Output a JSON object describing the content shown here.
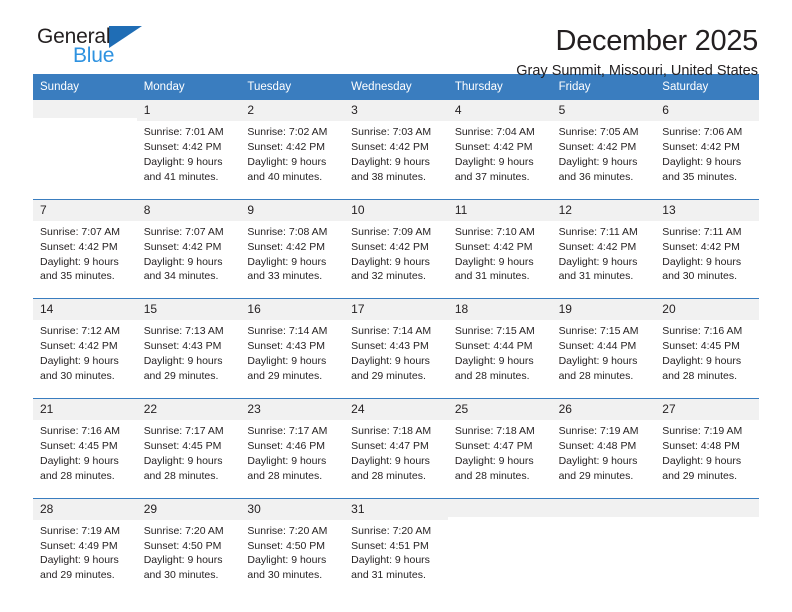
{
  "logo": {
    "line1": "General",
    "line2": "Blue",
    "triangle_color": "#1f6db5",
    "line2_color": "#2e92e0"
  },
  "header": {
    "title": "December 2025",
    "subtitle": "Gray Summit, Missouri, United States"
  },
  "calendar": {
    "header_bg": "#3a7dbf",
    "day_strip_bg": "#f1f1f1",
    "weekdays": [
      "Sunday",
      "Monday",
      "Tuesday",
      "Wednesday",
      "Thursday",
      "Friday",
      "Saturday"
    ],
    "weeks": [
      [
        {
          "day": "",
          "lines": []
        },
        {
          "day": "1",
          "lines": [
            "Sunrise: 7:01 AM",
            "Sunset: 4:42 PM",
            "Daylight: 9 hours",
            "and 41 minutes."
          ]
        },
        {
          "day": "2",
          "lines": [
            "Sunrise: 7:02 AM",
            "Sunset: 4:42 PM",
            "Daylight: 9 hours",
            "and 40 minutes."
          ]
        },
        {
          "day": "3",
          "lines": [
            "Sunrise: 7:03 AM",
            "Sunset: 4:42 PM",
            "Daylight: 9 hours",
            "and 38 minutes."
          ]
        },
        {
          "day": "4",
          "lines": [
            "Sunrise: 7:04 AM",
            "Sunset: 4:42 PM",
            "Daylight: 9 hours",
            "and 37 minutes."
          ]
        },
        {
          "day": "5",
          "lines": [
            "Sunrise: 7:05 AM",
            "Sunset: 4:42 PM",
            "Daylight: 9 hours",
            "and 36 minutes."
          ]
        },
        {
          "day": "6",
          "lines": [
            "Sunrise: 7:06 AM",
            "Sunset: 4:42 PM",
            "Daylight: 9 hours",
            "and 35 minutes."
          ]
        }
      ],
      [
        {
          "day": "7",
          "lines": [
            "Sunrise: 7:07 AM",
            "Sunset: 4:42 PM",
            "Daylight: 9 hours",
            "and 35 minutes."
          ]
        },
        {
          "day": "8",
          "lines": [
            "Sunrise: 7:07 AM",
            "Sunset: 4:42 PM",
            "Daylight: 9 hours",
            "and 34 minutes."
          ]
        },
        {
          "day": "9",
          "lines": [
            "Sunrise: 7:08 AM",
            "Sunset: 4:42 PM",
            "Daylight: 9 hours",
            "and 33 minutes."
          ]
        },
        {
          "day": "10",
          "lines": [
            "Sunrise: 7:09 AM",
            "Sunset: 4:42 PM",
            "Daylight: 9 hours",
            "and 32 minutes."
          ]
        },
        {
          "day": "11",
          "lines": [
            "Sunrise: 7:10 AM",
            "Sunset: 4:42 PM",
            "Daylight: 9 hours",
            "and 31 minutes."
          ]
        },
        {
          "day": "12",
          "lines": [
            "Sunrise: 7:11 AM",
            "Sunset: 4:42 PM",
            "Daylight: 9 hours",
            "and 31 minutes."
          ]
        },
        {
          "day": "13",
          "lines": [
            "Sunrise: 7:11 AM",
            "Sunset: 4:42 PM",
            "Daylight: 9 hours",
            "and 30 minutes."
          ]
        }
      ],
      [
        {
          "day": "14",
          "lines": [
            "Sunrise: 7:12 AM",
            "Sunset: 4:42 PM",
            "Daylight: 9 hours",
            "and 30 minutes."
          ]
        },
        {
          "day": "15",
          "lines": [
            "Sunrise: 7:13 AM",
            "Sunset: 4:43 PM",
            "Daylight: 9 hours",
            "and 29 minutes."
          ]
        },
        {
          "day": "16",
          "lines": [
            "Sunrise: 7:14 AM",
            "Sunset: 4:43 PM",
            "Daylight: 9 hours",
            "and 29 minutes."
          ]
        },
        {
          "day": "17",
          "lines": [
            "Sunrise: 7:14 AM",
            "Sunset: 4:43 PM",
            "Daylight: 9 hours",
            "and 29 minutes."
          ]
        },
        {
          "day": "18",
          "lines": [
            "Sunrise: 7:15 AM",
            "Sunset: 4:44 PM",
            "Daylight: 9 hours",
            "and 28 minutes."
          ]
        },
        {
          "day": "19",
          "lines": [
            "Sunrise: 7:15 AM",
            "Sunset: 4:44 PM",
            "Daylight: 9 hours",
            "and 28 minutes."
          ]
        },
        {
          "day": "20",
          "lines": [
            "Sunrise: 7:16 AM",
            "Sunset: 4:45 PM",
            "Daylight: 9 hours",
            "and 28 minutes."
          ]
        }
      ],
      [
        {
          "day": "21",
          "lines": [
            "Sunrise: 7:16 AM",
            "Sunset: 4:45 PM",
            "Daylight: 9 hours",
            "and 28 minutes."
          ]
        },
        {
          "day": "22",
          "lines": [
            "Sunrise: 7:17 AM",
            "Sunset: 4:45 PM",
            "Daylight: 9 hours",
            "and 28 minutes."
          ]
        },
        {
          "day": "23",
          "lines": [
            "Sunrise: 7:17 AM",
            "Sunset: 4:46 PM",
            "Daylight: 9 hours",
            "and 28 minutes."
          ]
        },
        {
          "day": "24",
          "lines": [
            "Sunrise: 7:18 AM",
            "Sunset: 4:47 PM",
            "Daylight: 9 hours",
            "and 28 minutes."
          ]
        },
        {
          "day": "25",
          "lines": [
            "Sunrise: 7:18 AM",
            "Sunset: 4:47 PM",
            "Daylight: 9 hours",
            "and 28 minutes."
          ]
        },
        {
          "day": "26",
          "lines": [
            "Sunrise: 7:19 AM",
            "Sunset: 4:48 PM",
            "Daylight: 9 hours",
            "and 29 minutes."
          ]
        },
        {
          "day": "27",
          "lines": [
            "Sunrise: 7:19 AM",
            "Sunset: 4:48 PM",
            "Daylight: 9 hours",
            "and 29 minutes."
          ]
        }
      ],
      [
        {
          "day": "28",
          "lines": [
            "Sunrise: 7:19 AM",
            "Sunset: 4:49 PM",
            "Daylight: 9 hours",
            "and 29 minutes."
          ]
        },
        {
          "day": "29",
          "lines": [
            "Sunrise: 7:20 AM",
            "Sunset: 4:50 PM",
            "Daylight: 9 hours",
            "and 30 minutes."
          ]
        },
        {
          "day": "30",
          "lines": [
            "Sunrise: 7:20 AM",
            "Sunset: 4:50 PM",
            "Daylight: 9 hours",
            "and 30 minutes."
          ]
        },
        {
          "day": "31",
          "lines": [
            "Sunrise: 7:20 AM",
            "Sunset: 4:51 PM",
            "Daylight: 9 hours",
            "and 31 minutes."
          ]
        },
        {
          "day": "",
          "lines": []
        },
        {
          "day": "",
          "lines": []
        },
        {
          "day": "",
          "lines": []
        }
      ]
    ]
  }
}
